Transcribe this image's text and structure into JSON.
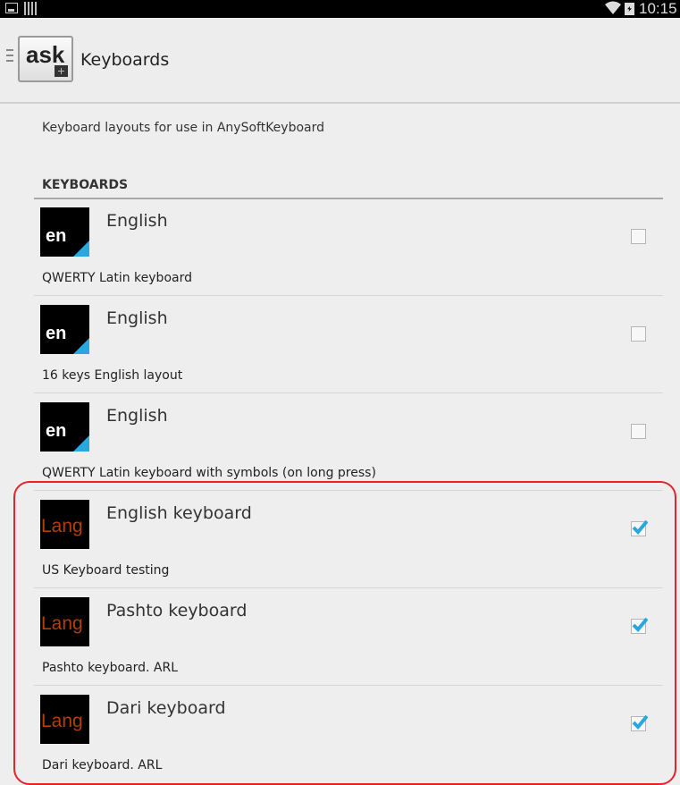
{
  "status_bar": {
    "time": "10:15"
  },
  "app_bar": {
    "logo_text": "ask",
    "title": "Keyboards"
  },
  "description": "Keyboard layouts for use in AnySoftKeyboard",
  "section_header": "KEYBOARDS",
  "keyboards": [
    {
      "icon_label": "en",
      "name": "English",
      "description": "QWERTY Latin keyboard",
      "checked": false
    },
    {
      "icon_label": "en",
      "name": "English",
      "description": "16 keys English layout",
      "checked": false
    },
    {
      "icon_label": "en",
      "name": "English",
      "description": "QWERTY Latin keyboard with symbols (on long press)",
      "checked": false
    },
    {
      "icon_label": "Lang",
      "name": "English keyboard",
      "description": "US Keyboard testing",
      "checked": true
    },
    {
      "icon_label": "Lang",
      "name": "Pashto keyboard",
      "description": "Pashto keyboard. ARL",
      "checked": true
    },
    {
      "icon_label": "Lang",
      "name": "Dari keyboard",
      "description": "Dari keyboard. ARL",
      "checked": true
    }
  ],
  "colors": {
    "accent": "#29a8e0",
    "highlight_outline": "#e3242b",
    "lang_icon_text": "#b0400a"
  },
  "icons": [
    "image-icon",
    "signal-icon",
    "wifi-icon",
    "battery-icon",
    "drawer-icon",
    "app-logo-icon",
    "checkbox"
  ]
}
